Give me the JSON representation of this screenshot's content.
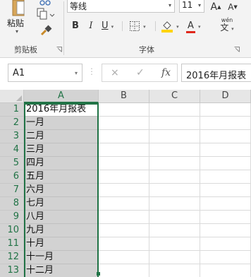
{
  "ribbon": {
    "clipboard": {
      "paste_label": "粘贴",
      "group_label": "剪贴板",
      "icons": [
        "clipboard-icon",
        "cut-icon",
        "copy-icon",
        "format-painter-icon"
      ]
    },
    "font": {
      "font_name": "等线",
      "font_size": "11",
      "grow_label": "A",
      "shrink_label": "A",
      "wen_label": "wén",
      "wen_char": "文",
      "bold_label": "B",
      "italic_label": "I",
      "underline_label": "U",
      "font_color_label": "A",
      "group_label": "字体",
      "colors": {
        "fill": "#ffd400",
        "font": "#e0281b",
        "accent": "#217346"
      }
    }
  },
  "formula_bar": {
    "name_box": "A1",
    "cancel_icon": "×",
    "enter_icon": "✓",
    "fx_label": "fx",
    "formula": "2016年月报表"
  },
  "sheet": {
    "columns": [
      "A",
      "B",
      "C",
      "D"
    ],
    "rows": [
      {
        "num": "1",
        "a": "2016年月报表"
      },
      {
        "num": "2",
        "a": "一月"
      },
      {
        "num": "3",
        "a": "二月"
      },
      {
        "num": "4",
        "a": "三月"
      },
      {
        "num": "5",
        "a": "四月"
      },
      {
        "num": "6",
        "a": "五月"
      },
      {
        "num": "7",
        "a": "六月"
      },
      {
        "num": "8",
        "a": "七月"
      },
      {
        "num": "9",
        "a": "八月"
      },
      {
        "num": "10",
        "a": "九月"
      },
      {
        "num": "11",
        "a": "十月"
      },
      {
        "num": "12",
        "a": "十一月"
      },
      {
        "num": "13",
        "a": "十二月"
      }
    ]
  }
}
